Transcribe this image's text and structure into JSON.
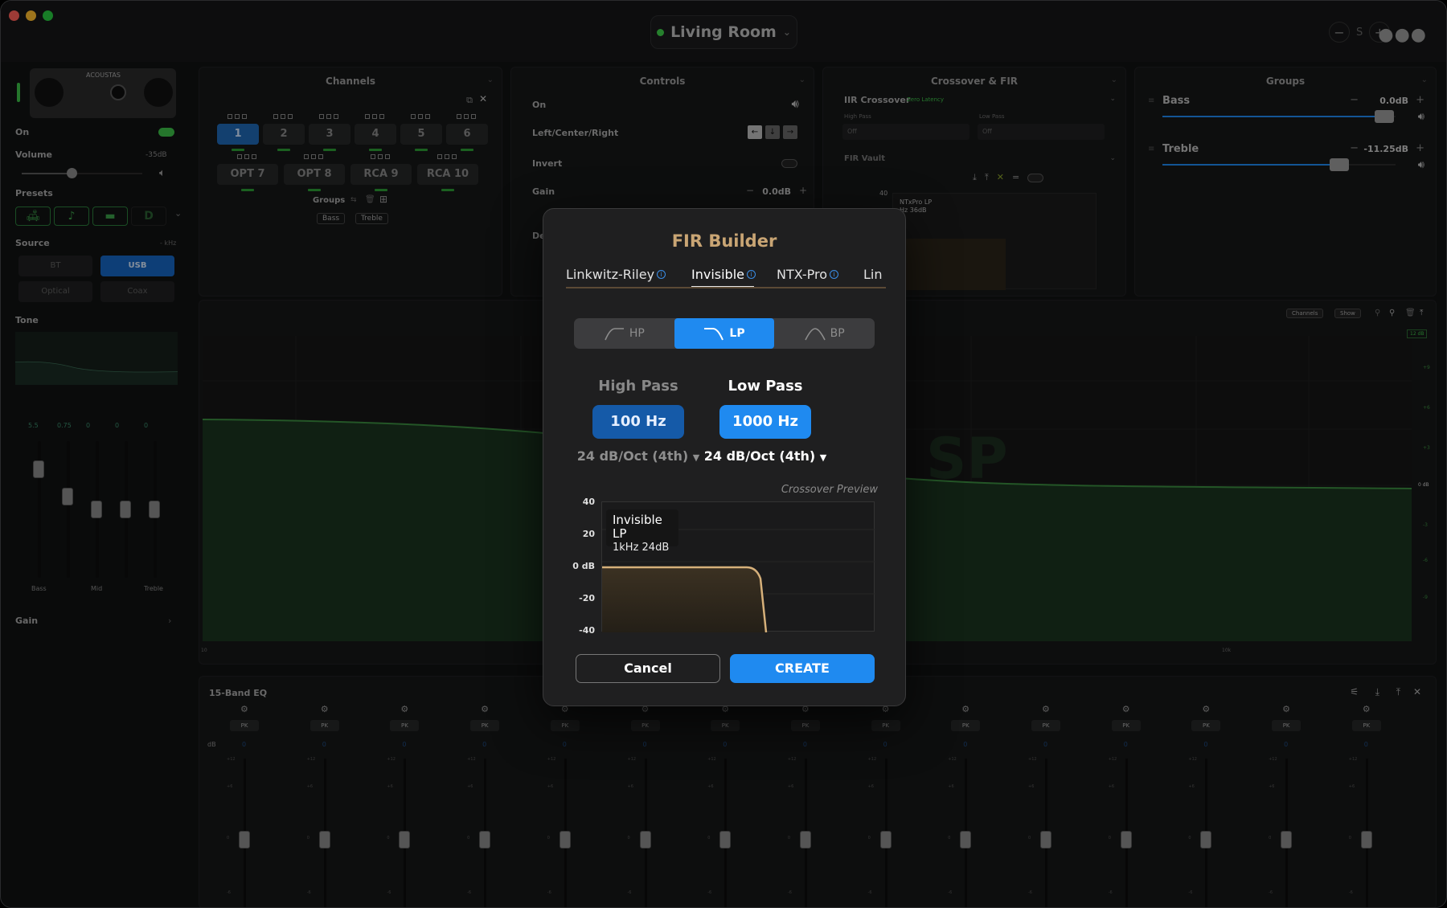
{
  "window": {
    "room": "Living Room",
    "s_label": "S"
  },
  "sidebar": {
    "on_label": "On",
    "volume_label": "Volume",
    "volume_value": "-35dB",
    "presets_label": "Presets",
    "preset_d": "D",
    "source_label": "Source",
    "source_unit": "- kHz",
    "sources": [
      "BT",
      "USB",
      "Optical",
      "Coax"
    ],
    "tone_label": "Tone",
    "tone_values": [
      "5.5",
      "0.75",
      "0",
      "0",
      "0"
    ],
    "tone_bands": [
      "Bass",
      "Mid",
      "Treble"
    ],
    "gain_label": "Gain",
    "device_brand": "ACOUSTAS"
  },
  "channels": {
    "title": "Channels",
    "buttons": [
      "1",
      "2",
      "3",
      "4",
      "5",
      "6",
      "OPT 7",
      "OPT 8",
      "RCA 9",
      "RCA 10"
    ],
    "groups_label": "Groups",
    "groups": [
      "Bass",
      "Treble"
    ]
  },
  "controls": {
    "title": "Controls",
    "on": "On",
    "lcr": "Left/Center/Right",
    "invert": "Invert",
    "gain": "Gain",
    "gain_value": "0.0dB",
    "de": "De"
  },
  "crossover": {
    "title": "Crossover & FIR",
    "iir": "IIR Crossover",
    "zero_latency": "Zero Latency",
    "high_pass": "High Pass",
    "low_pass": "Low Pass",
    "hp_val": "Off",
    "lp_val": "Off",
    "vault": "FIR Vault",
    "mini_40": "40",
    "mini_label": "NTxPro LP",
    "mini_sub": "Hz 36dB"
  },
  "groups": {
    "title": "Groups",
    "items": [
      {
        "name": "Bass",
        "value": "0.0dB",
        "level": 0.95
      },
      {
        "name": "Treble",
        "value": "-11.25dB",
        "level": 0.76
      }
    ]
  },
  "graph": {
    "channels_btn": "Channels",
    "show_btn": "Show",
    "badge": "12 dB",
    "zero": "0 dB",
    "right_ticks": [
      "+9",
      "+6",
      "+3",
      "-3",
      "-6",
      "-9"
    ],
    "x_ticks": [
      "10",
      "10k"
    ],
    "watermark": "SP"
  },
  "eq": {
    "title": "15-Band EQ",
    "db": "dB",
    "type": "PK",
    "value": "0",
    "scale": [
      "+12",
      "+6",
      "0",
      "-6"
    ],
    "bands": 15
  },
  "modal": {
    "title": "FIR Builder",
    "tabs": [
      "Linkwitz-Riley",
      "Invisible",
      "NTX-Pro",
      "Lin"
    ],
    "selected_tab": "Invisible",
    "modes": [
      "HP",
      "LP",
      "BP"
    ],
    "selected_mode": "LP",
    "high_pass_label": "High Pass",
    "low_pass_label": "Low Pass",
    "high_pass_freq": "100 Hz",
    "low_pass_freq": "1000 Hz",
    "high_pass_slope": "24 dB/Oct (4th)",
    "low_pass_slope": "24 dB/Oct (4th)",
    "preview_label": "Crossover Preview",
    "y_ticks": [
      "40",
      "20",
      "0 dB",
      "-20",
      "-40"
    ],
    "tooltip_title": "Invisible LP",
    "tooltip_sub": "1kHz 24dB",
    "cancel": "Cancel",
    "create": "CREATE",
    "accent": "#1f8af0",
    "title_color": "#c9a574"
  }
}
